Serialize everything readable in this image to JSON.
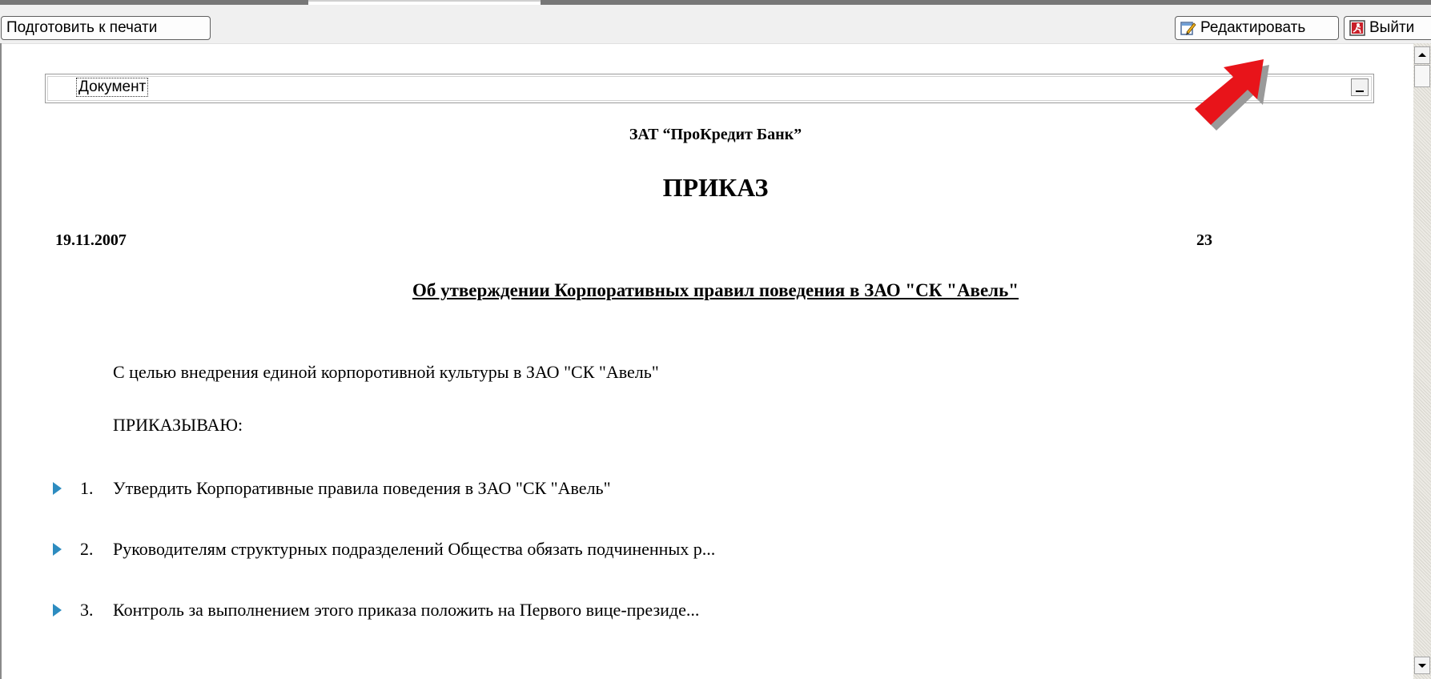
{
  "toolbar": {
    "print_label": "Подготовить к печати",
    "edit_label": "Редактировать",
    "exit_label": "Выйти"
  },
  "doc_panel": {
    "label": "Документ"
  },
  "document": {
    "organization": "ЗАТ “ПроКредит Банк”",
    "title": "ПРИКАЗ",
    "date": "19.11.2007",
    "number": "23",
    "subject": "Об утверждении Корпоративных правил поведения в ЗАО \"СК \"Авель\"",
    "purpose": "С целью внедрения единой корпоротивной культуры в ЗАО \"СК \"Авель\"",
    "orders_heading": "ПРИКАЗЫВАЮ:",
    "items": [
      {
        "num": "1.",
        "text": "Утвердить Корпоративные правила поведения в ЗАО \"СК \"Авель\""
      },
      {
        "num": "2.",
        "text": "Руководителям структурных подразделений Общества обязать подчиненных р..."
      },
      {
        "num": "3.",
        "text": "Контроль за выполнением этого приказа положить на Первого вице-президе..."
      }
    ]
  },
  "colors": {
    "arrow": "#e8141a",
    "bullet": "#2d8cc0"
  },
  "icons": [
    "edit-icon",
    "exit-icon",
    "minimize-icon",
    "scroll-up-icon",
    "scroll-down-icon",
    "expand-triangle-icon",
    "pointer-arrow"
  ]
}
